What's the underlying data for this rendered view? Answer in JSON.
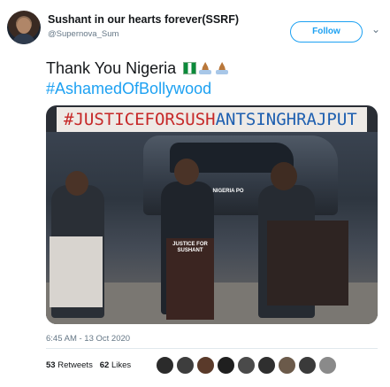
{
  "tweet": {
    "author_name": "Sushant in our hearts forever(SSRF)",
    "author_handle": "@Supernova_Sum",
    "follow_label": "Follow",
    "caret_icon": "chevron-down-icon",
    "text_line1": "Thank You Nigeria",
    "text_line2": "#AshamedOfBollywood",
    "emojis": [
      "nigeria-flag-icon",
      "folded-hands-icon",
      "folded-hands-icon"
    ],
    "image_banner_red": "#JUSTICEFORSUSH",
    "image_banner_blue": "ANTSINGHRAJPUT",
    "image_sign_1": "JUSTICE FOR SUSHANT",
    "image_sign_2": "NIGERIA PO",
    "timestamp": "6:45 AM - 13 Oct 2020",
    "retweets_count": "53",
    "retweets_label": "Retweets",
    "likes_count": "62",
    "likes_label": "Likes"
  },
  "colors": {
    "link_blue": "#1da1f2",
    "banner_red": "#c62828",
    "banner_blue": "#1e5fb0",
    "muted": "#657786"
  }
}
